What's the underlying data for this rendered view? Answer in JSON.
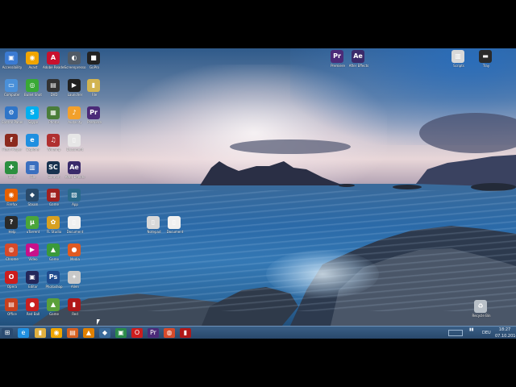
{
  "desktop": {
    "icons": [
      {
        "label": "Accessibility",
        "glyph": "▣",
        "color": "#3b7bd3"
      },
      {
        "label": "Avast",
        "glyph": "◉",
        "color": "#f0a500"
      },
      {
        "label": "Adobe Reader",
        "glyph": "A",
        "color": "#c8102e"
      },
      {
        "label": "Screenpresso",
        "glyph": "◐",
        "color": "#505a66"
      },
      {
        "label": "GoPro",
        "glyph": "■",
        "color": "#222"
      },
      {
        "label": "Computer",
        "glyph": "▭",
        "color": "#4a90d9"
      },
      {
        "label": "Bullet Shot",
        "glyph": "◎",
        "color": "#39a935"
      },
      {
        "label": "DVD",
        "glyph": "▤",
        "color": "#333"
      },
      {
        "label": "Launcher",
        "glyph": "▶",
        "color": "#202020"
      },
      {
        "label": "File",
        "glyph": "▮",
        "color": "#d2b450"
      },
      {
        "label": "Control Panel",
        "glyph": "⚙",
        "color": "#2f75c8"
      },
      {
        "label": "Skype",
        "glyph": "S",
        "color": "#00aff0"
      },
      {
        "label": "Photos",
        "glyph": "▦",
        "color": "#4a7d3a"
      },
      {
        "label": "Audacity",
        "glyph": "♪",
        "color": "#f2a02c"
      },
      {
        "label": "Premiere",
        "glyph": "Pr",
        "color": "#4b2a78"
      },
      {
        "label": "Flash Player",
        "glyph": "f",
        "color": "#8c2a1e"
      },
      {
        "label": "Explorer",
        "glyph": "e",
        "color": "#1f8fe0"
      },
      {
        "label": "Winamp",
        "glyph": "♫",
        "color": "#b03030"
      },
      {
        "label": "Document",
        "glyph": "▯",
        "color": "#e6e6e6"
      },
      {
        "label": "Tools",
        "glyph": "✚",
        "color": "#2c8f3f"
      },
      {
        "label": "File",
        "glyph": "▥",
        "color": "#3b6fbf"
      },
      {
        "label": "Scratch",
        "glyph": "SC",
        "color": "#18324f"
      },
      {
        "label": "After Effects",
        "glyph": "Ae",
        "color": "#3a2a6a"
      },
      {
        "label": "Firefox",
        "glyph": "◉",
        "color": "#e66000"
      },
      {
        "label": "Steam",
        "glyph": "◆",
        "color": "#2a4a6a"
      },
      {
        "label": "Game",
        "glyph": "▩",
        "color": "#a02020"
      },
      {
        "label": "App",
        "glyph": "▧",
        "color": "#2a6a8a"
      },
      {
        "label": "Help",
        "glyph": "?",
        "color": "#2a2a2a"
      },
      {
        "label": "uTorrent",
        "glyph": "µ",
        "color": "#4aa53a"
      },
      {
        "label": "FL Studio",
        "glyph": "✿",
        "color": "#d8a020"
      },
      {
        "label": "Document",
        "glyph": "▯",
        "color": "#f0f0f0"
      },
      {
        "label": "Chrome",
        "glyph": "◍",
        "color": "#d64a2a"
      },
      {
        "label": "Video",
        "glyph": "▶",
        "color": "#c8108a"
      },
      {
        "label": "Game",
        "glyph": "▲",
        "color": "#3a9a3a"
      },
      {
        "label": "Media",
        "glyph": "●",
        "color": "#e05a20"
      },
      {
        "label": "Opera",
        "glyph": "O",
        "color": "#cc1d1d"
      },
      {
        "label": "Editor",
        "glyph": "▣",
        "color": "#23285a"
      },
      {
        "label": "Photoshop",
        "glyph": "Ps",
        "color": "#1f4b8e"
      },
      {
        "label": "Alien",
        "glyph": "✦",
        "color": "#c8c8c8"
      },
      {
        "label": "Office",
        "glyph": "▤",
        "color": "#c8401e"
      },
      {
        "label": "Red Ball",
        "glyph": "●",
        "color": "#c82020"
      },
      {
        "label": "Game",
        "glyph": "▲",
        "color": "#5aa03a"
      },
      {
        "label": "Red",
        "glyph": "▮",
        "color": "#b01818"
      },
      {
        "label": "Premiere",
        "glyph": "Pr",
        "color": "#4b2a78"
      },
      {
        "label": "After Effects",
        "glyph": "Ae",
        "color": "#3a2a6a"
      },
      {
        "label": "Notepad",
        "glyph": "▯",
        "color": "#d8d8d8"
      },
      {
        "label": "Document",
        "glyph": "▯",
        "color": "#f0f0f0"
      },
      {
        "label": "Scripts",
        "glyph": "▥",
        "color": "#d8d8d8"
      },
      {
        "label": "Tray",
        "glyph": "▬",
        "color": "#2a2a2a"
      },
      {
        "label": "Recycle Bin",
        "glyph": "♻",
        "color": "#b8c0c8"
      }
    ]
  },
  "taskbar": {
    "items": [
      {
        "name": "start-button",
        "glyph": "⊞",
        "color": "#2a4a70"
      },
      {
        "name": "ie-icon",
        "glyph": "e",
        "color": "#1f8fe0"
      },
      {
        "name": "folder-icon",
        "glyph": "▮",
        "color": "#e0b040"
      },
      {
        "name": "media-icon",
        "glyph": "◉",
        "color": "#f0a500"
      },
      {
        "name": "chart-icon",
        "glyph": "▤",
        "color": "#d86020"
      },
      {
        "name": "vlc-icon",
        "glyph": "▲",
        "color": "#e08000"
      },
      {
        "name": "app-icon",
        "glyph": "◆",
        "color": "#3a6a9a"
      },
      {
        "name": "green-icon",
        "glyph": "▣",
        "color": "#2a8a4a"
      },
      {
        "name": "opera-icon",
        "glyph": "O",
        "color": "#cc1d1d"
      },
      {
        "name": "premiere-icon",
        "glyph": "Pr",
        "color": "#4b2a78"
      },
      {
        "name": "chrome-icon",
        "glyph": "◍",
        "color": "#d64a2a"
      },
      {
        "name": "red-icon",
        "glyph": "▮",
        "color": "#b01818"
      }
    ],
    "tray_lang": "DEU",
    "tray_time": "18:27",
    "tray_date": "07.10.2014"
  }
}
